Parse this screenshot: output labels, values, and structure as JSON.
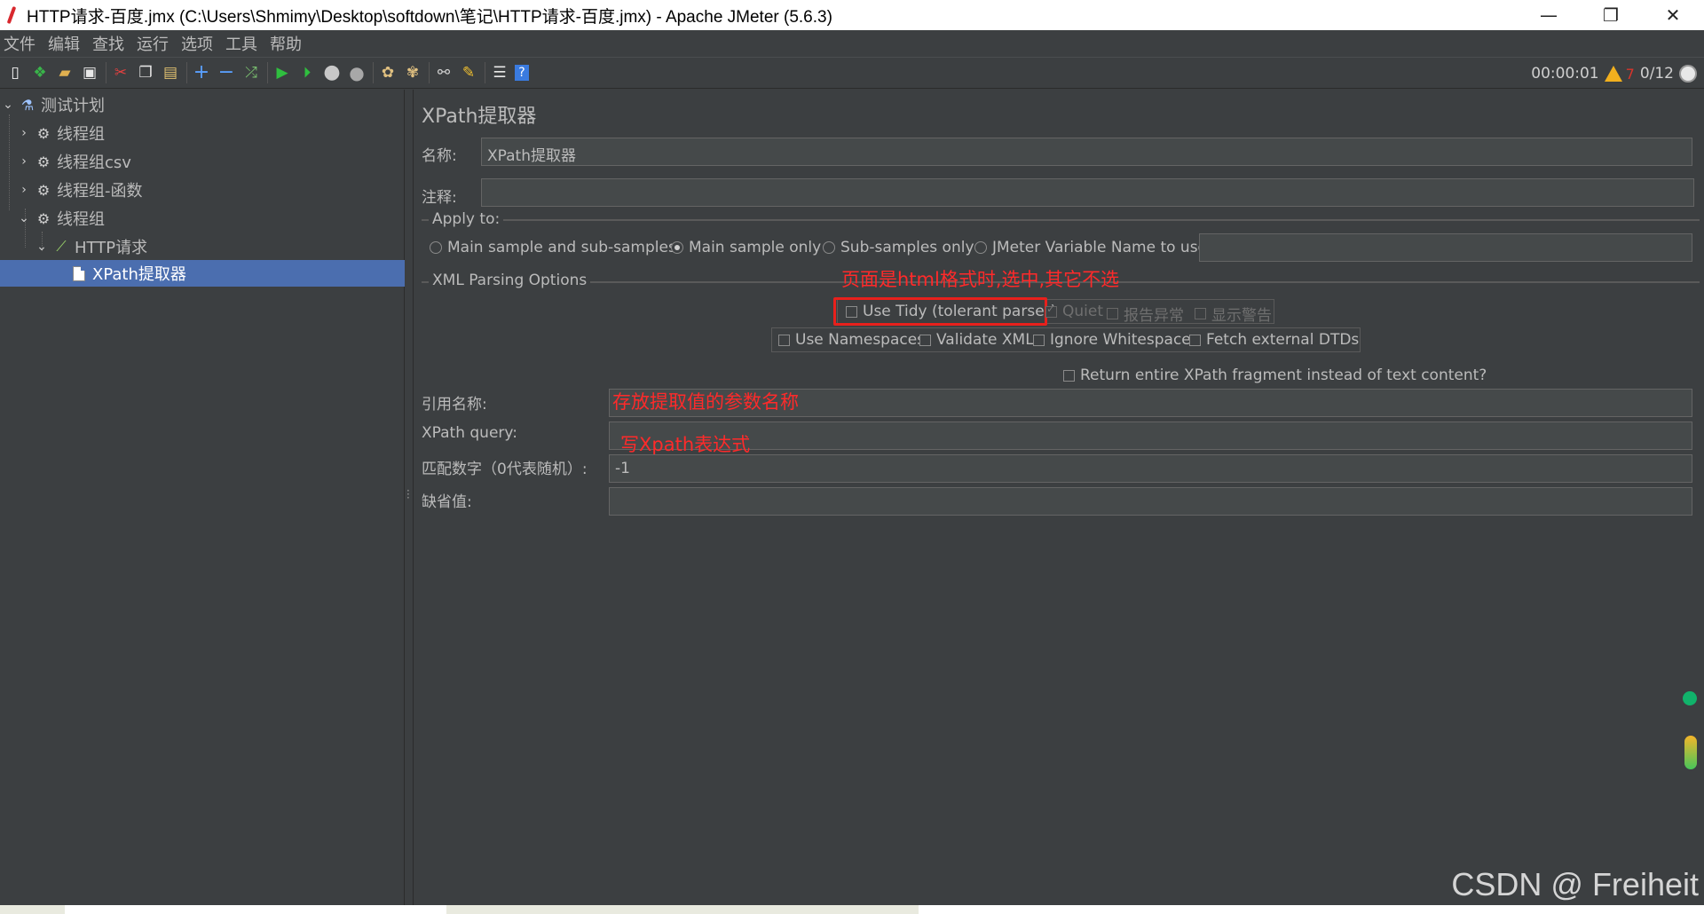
{
  "window": {
    "title": "HTTP请求-百度.jmx (C:\\Users\\Shmimy\\Desktop\\softdown\\笔记\\HTTP请求-百度.jmx) - Apache JMeter (5.6.3)",
    "minimize": "—",
    "restore": "❐",
    "close": "✕"
  },
  "menu": [
    "文件",
    "编辑",
    "查找",
    "运行",
    "选项",
    "工具",
    "帮助"
  ],
  "status": {
    "elapsed": "00:00:01",
    "warnings": "7",
    "threads": "0/12"
  },
  "tree": {
    "root": "测试计划",
    "children": [
      "线程组",
      "线程组csv",
      "线程组-函数",
      "线程组"
    ],
    "sampler": "HTTP请求",
    "selected": "XPath提取器"
  },
  "panel": {
    "title": "XPath提取器",
    "name_label": "名称:",
    "name_value": "XPath提取器",
    "comment_label": "注释:",
    "comment_value": "",
    "apply_to_label": "Apply to:",
    "apply_options": [
      "Main sample and sub-samples",
      "Main sample only",
      "Sub-samples only",
      "JMeter Variable Name to use"
    ],
    "apply_selected": "Main sample only",
    "xml_options_label": "XML Parsing Options",
    "use_tidy": "Use Tidy (tolerant parser)",
    "quiet": "Quiet",
    "report_errors": "报告异常",
    "show_warnings": "显示警告",
    "use_namespaces": "Use Namespaces",
    "validate_xml": "Validate XML",
    "ignore_whitespace": "Ignore Whitespace",
    "fetch_dtds": "Fetch external DTDs",
    "return_fragment": "Return entire XPath fragment instead of text content?",
    "refname_label": "引用名称:",
    "refname_value": "",
    "query_label": "XPath query:",
    "query_value": "",
    "match_label": "匹配数字（0代表随机）:",
    "match_value": "-1",
    "default_label": "缺省值:",
    "default_value": ""
  },
  "annotations": {
    "tidy_note": "页面是html格式时,选中,其它不选",
    "refname_note": "存放提取值的参数名称",
    "query_note": "写Xpath表达式"
  },
  "watermark": "CSDN @ Freiheit",
  "colors": {
    "background": "#3c3f41",
    "selection": "#4b6eaf",
    "annotation": "#ff2a2a"
  }
}
